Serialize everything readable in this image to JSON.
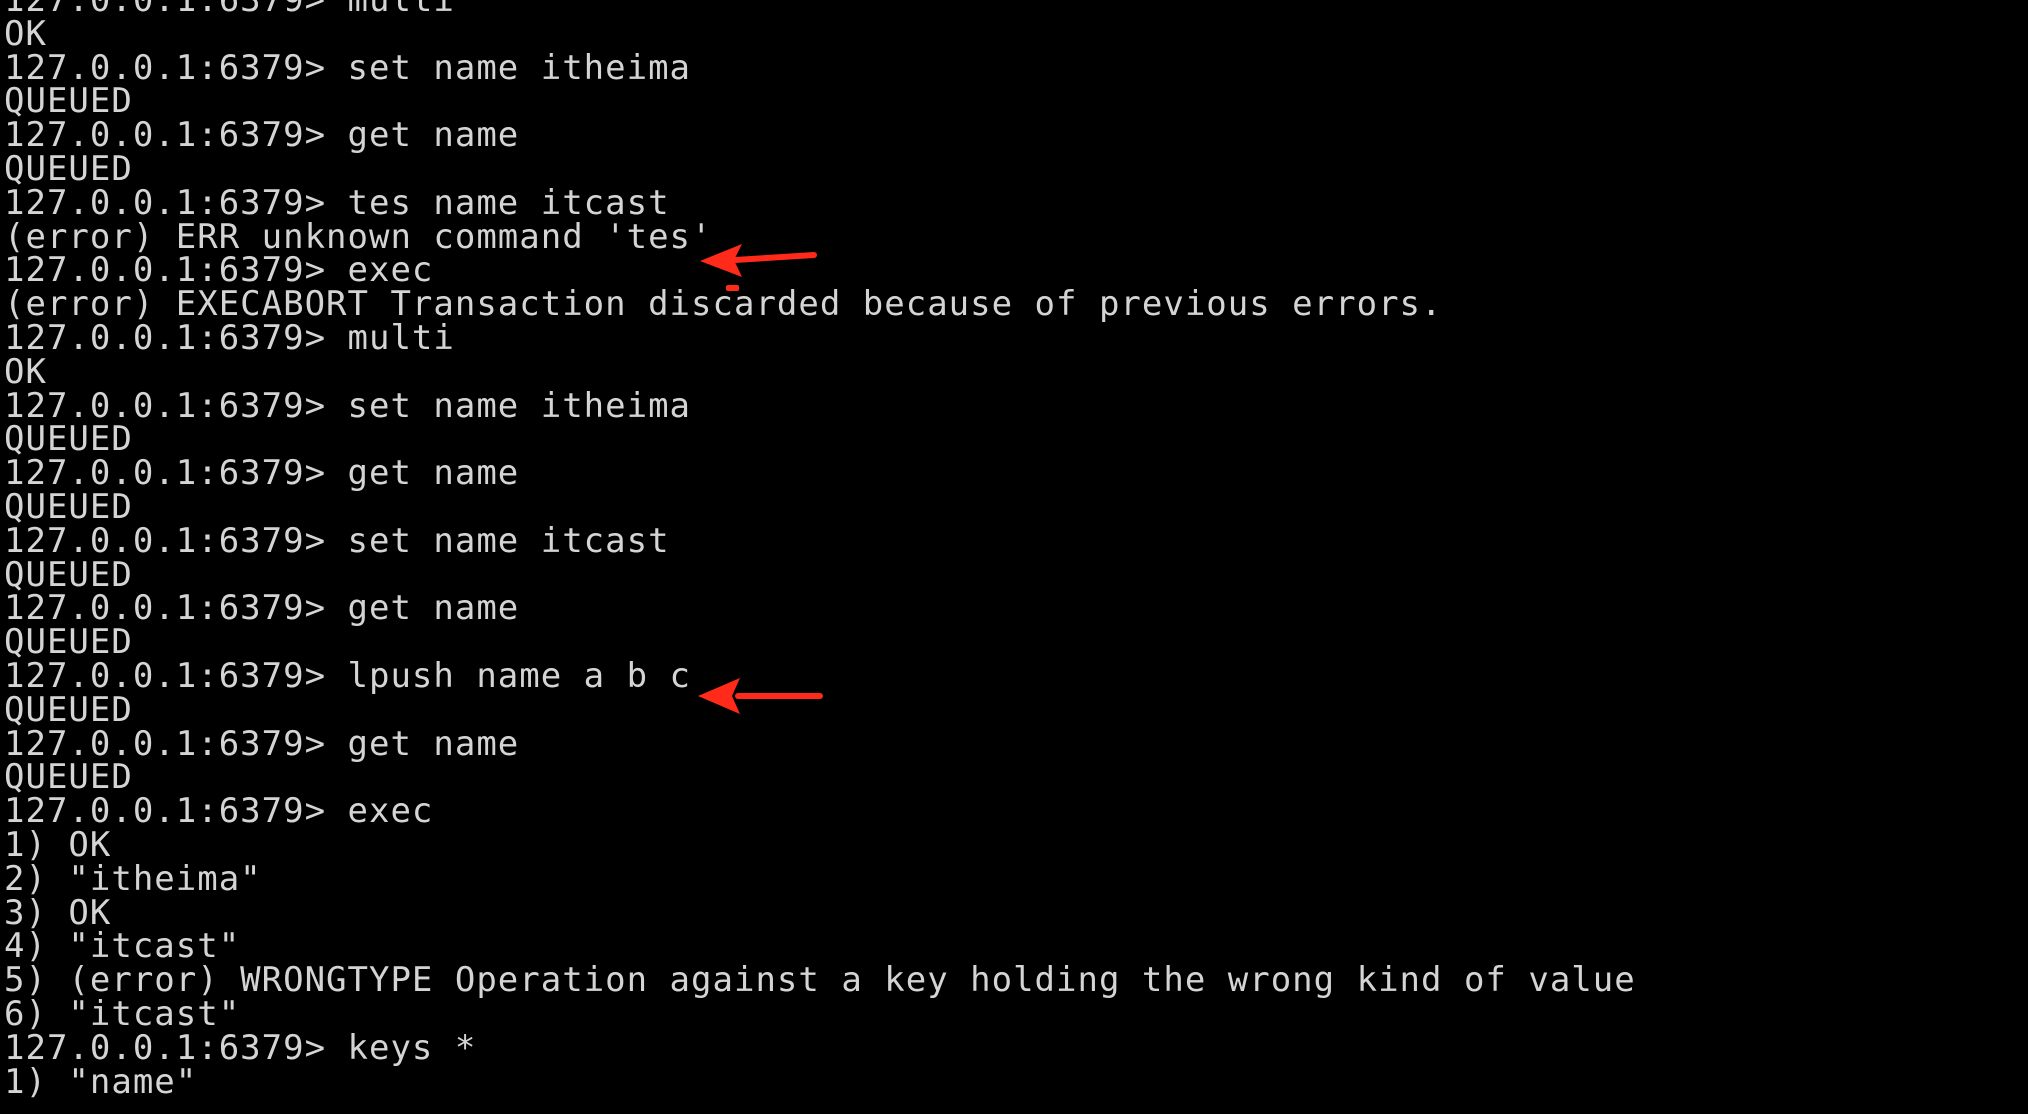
{
  "terminal": {
    "lines": [
      "127.0.0.1:6379> multi",
      "OK",
      "127.0.0.1:6379> set name itheima",
      "QUEUED",
      "127.0.0.1:6379> get name",
      "QUEUED",
      "127.0.0.1:6379> tes name itcast",
      "(error) ERR unknown command 'tes'",
      "127.0.0.1:6379> exec",
      "(error) EXECABORT Transaction discarded because of previous errors.",
      "127.0.0.1:6379> multi",
      "OK",
      "127.0.0.1:6379> set name itheima",
      "QUEUED",
      "127.0.0.1:6379> get name",
      "QUEUED",
      "127.0.0.1:6379> set name itcast",
      "QUEUED",
      "127.0.0.1:6379> get name",
      "QUEUED",
      "127.0.0.1:6379> lpush name a b c",
      "QUEUED",
      "127.0.0.1:6379> get name",
      "QUEUED",
      "127.0.0.1:6379> exec",
      "1) OK",
      "2) \"itheima\"",
      "3) OK",
      "4) \"itcast\"",
      "5) (error) WRONGTYPE Operation against a key holding the wrong kind of value",
      "6) \"itcast\"",
      "127.0.0.1:6379> keys *",
      "1) \"name\""
    ]
  },
  "annotations": {
    "arrow_color": "#ff2a1a",
    "icons": [
      "arrow-left-icon",
      "arrow-left-icon",
      "red-mark-icon"
    ]
  }
}
